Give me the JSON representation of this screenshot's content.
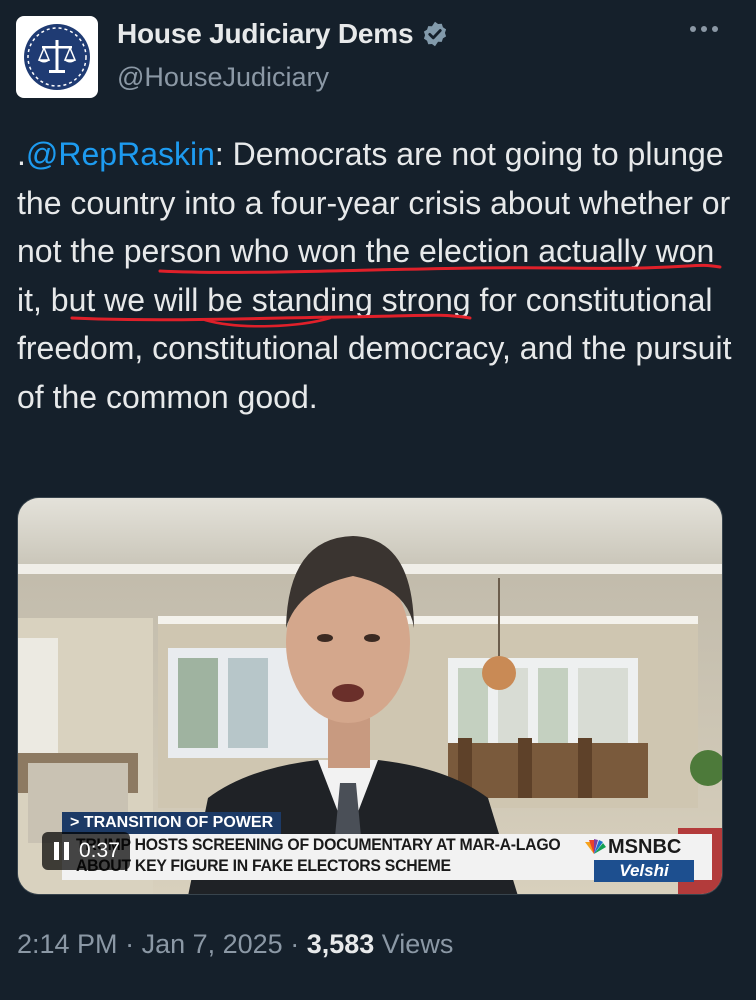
{
  "account": {
    "display_name": "House Judiciary Dems",
    "handle": "@HouseJudiciary",
    "verified_icon": "verified-badge-icon",
    "avatar_icon": "scales-of-justice-icon",
    "more_icon": "more-options-icon"
  },
  "tweet": {
    "prefix": ".",
    "mention": "@RepRaskin",
    "text_part1": ": Democrats are not going to plunge the country into a four-year crisis about ",
    "underlined_1": "whether or not the person who won",
    "text_part2": " the ",
    "underlined_2": "election actually won it,",
    "text_part3": " but we will be standing strong for constitutional freedom, constitutional democracy, and the pursuit of the common good."
  },
  "video": {
    "tag": "> TRANSITION OF POWER",
    "headline_line1": "TRUMP HOSTS SCREENING OF DOCUMENTARY AT MAR-A-LAGO",
    "headline_line2": "ABOUT KEY FIGURE IN FAKE ELECTORS SCHEME",
    "network": "MSNBC",
    "show": "Velshi",
    "elapsed": "0:37",
    "play_state_icon": "pause-icon"
  },
  "meta": {
    "time": "2:14 PM",
    "date": "Jan 7, 2025",
    "views_count": "3,583",
    "views_label": "Views"
  },
  "colors": {
    "background": "#15202b",
    "mention": "#1d9bf0",
    "scribble": "#e0202a",
    "secondary_text": "#8b98a5"
  }
}
